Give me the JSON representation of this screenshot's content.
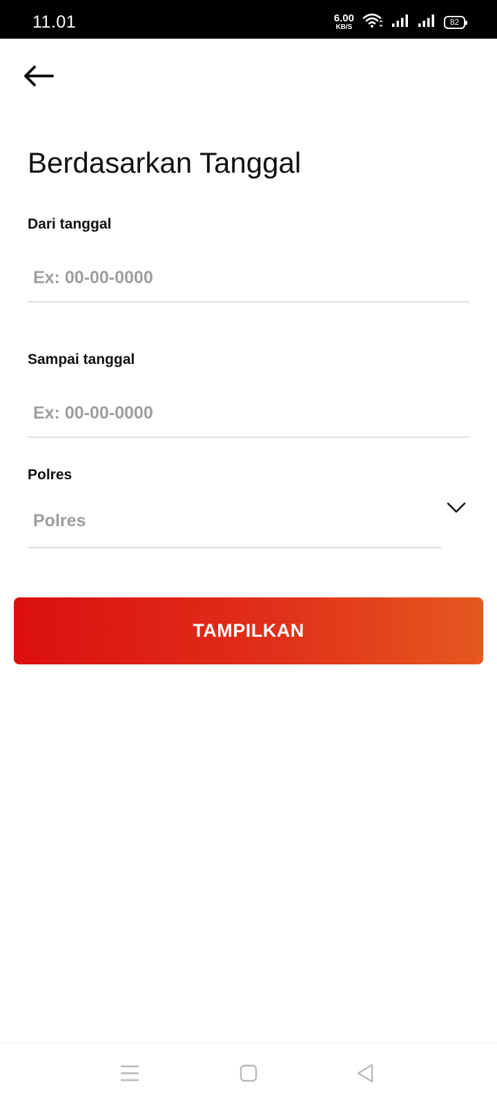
{
  "status_bar": {
    "time": "11.01",
    "net_speed_value": "6.00",
    "net_speed_unit": "KB/S",
    "battery": "82"
  },
  "header": {
    "title": "Berdasarkan Tanggal"
  },
  "form": {
    "from_date": {
      "label": "Dari tanggal",
      "value": "",
      "placeholder": "Ex: 00-00-0000"
    },
    "to_date": {
      "label": "Sampai tanggal",
      "value": "",
      "placeholder": "Ex: 00-00-0000"
    },
    "polres": {
      "label": "Polres",
      "selected": "Polres"
    },
    "submit_label": "TAMPILKAN"
  },
  "colors": {
    "button_gradient_start": "#db0f0f",
    "button_gradient_end": "#e5581e",
    "status_bar_bg": "#000000",
    "placeholder": "#9e9e9e"
  },
  "icons": {
    "back": "arrow-left-icon",
    "dropdown": "chevron-down-icon",
    "wifi": "wifi-icon",
    "signal": "signal-icon",
    "nav_menu": "menu-icon",
    "nav_home": "square-icon",
    "nav_back": "triangle-back-icon"
  }
}
